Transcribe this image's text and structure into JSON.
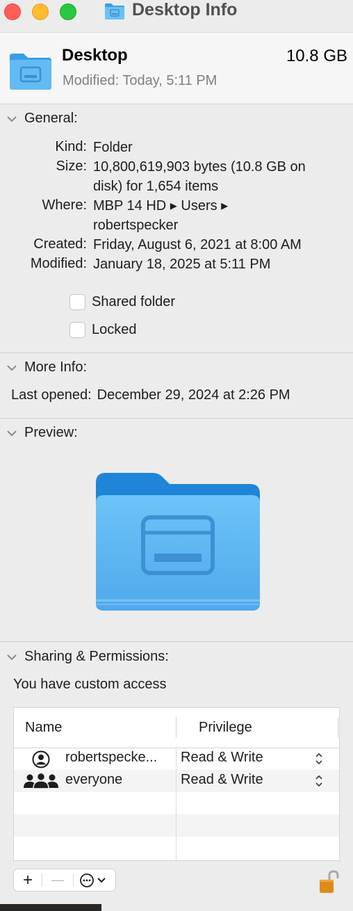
{
  "window": {
    "title": "Desktop Info"
  },
  "header": {
    "name": "Desktop",
    "size": "10.8 GB",
    "modified": "Modified:  Today, 5:11 PM"
  },
  "general": {
    "heading": "General:",
    "kind_label": "Kind:",
    "kind": "Folder",
    "size_label": "Size:",
    "size_line1": "10,800,619,903 bytes (10.8 GB on",
    "size_line2": "disk) for 1,654 items",
    "where_label": "Where:",
    "where_line1": "MBP 14 HD ▸ Users ▸",
    "where_line2": "robertspecker",
    "created_label": "Created:",
    "created": "Friday, August 6, 2021 at 8:00 AM",
    "modified_label": "Modified:",
    "modified": "January 18, 2025 at 5:11 PM",
    "shared_folder_label": "Shared folder",
    "locked_label": "Locked"
  },
  "more_info": {
    "heading": "More Info:",
    "last_opened_label": "Last opened:",
    "last_opened": "December 29, 2024 at 2:26 PM"
  },
  "preview": {
    "heading": "Preview:"
  },
  "sharing": {
    "heading": "Sharing & Permissions:",
    "access_text": "You have custom access",
    "columns": [
      "Name",
      "Privilege"
    ],
    "rows": [
      {
        "name": "robertspecke...",
        "privilege": "Read & Write",
        "icon": "user-icon"
      },
      {
        "name": "everyone",
        "privilege": "Read & Write",
        "icon": "group-icon"
      }
    ],
    "add_symbol": "+",
    "remove_symbol": "—"
  },
  "colors": {
    "folder_blue": "#5ab4f0",
    "folder_tab": "#3a9ee6",
    "lock_orange": "#e08a1c"
  }
}
